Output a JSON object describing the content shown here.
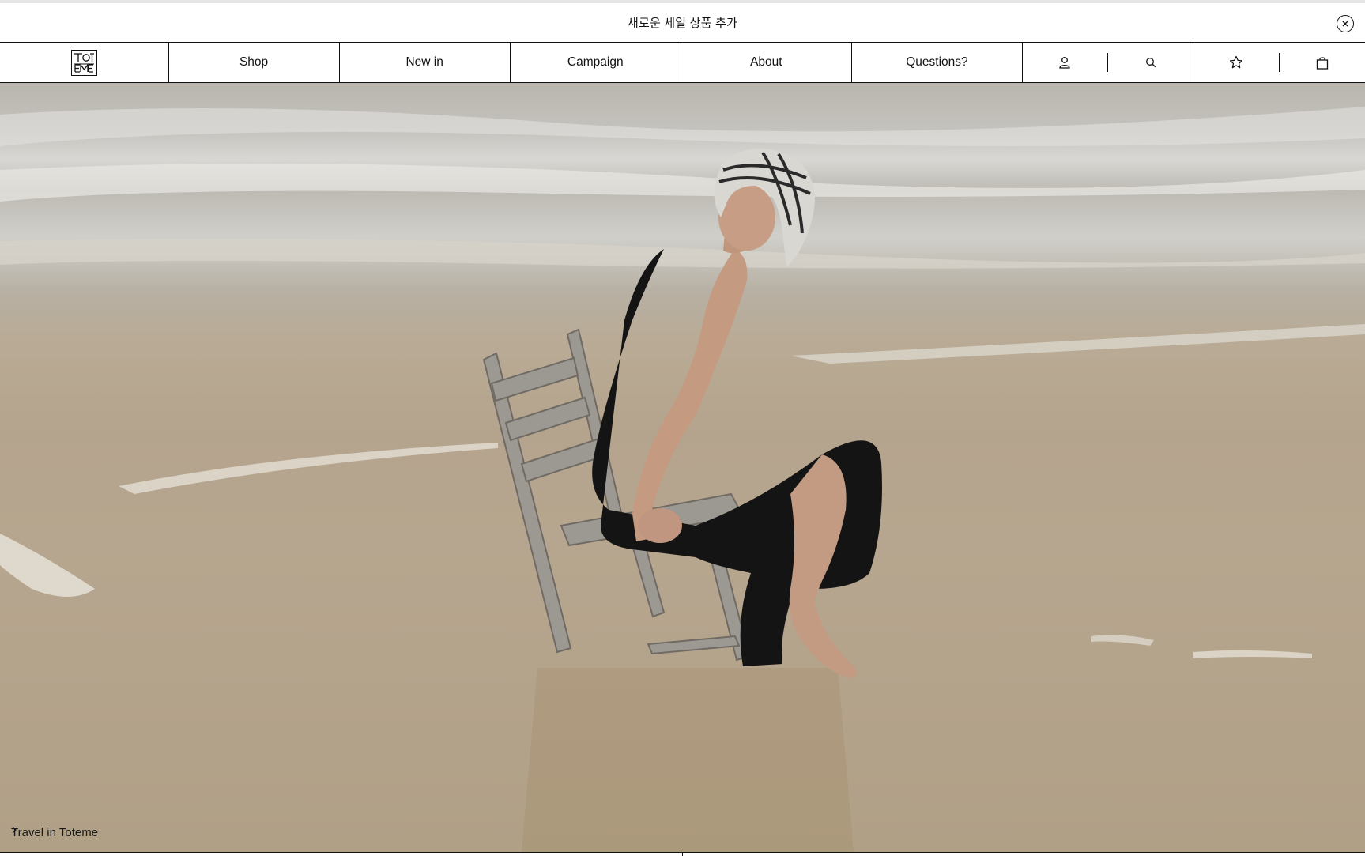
{
  "announcement": {
    "text": "새로운 세일 상품 추가",
    "close_icon": "close-icon"
  },
  "nav": {
    "logo_icon": "totem-logo",
    "links": [
      {
        "label": "Shop"
      },
      {
        "label": "New in"
      },
      {
        "label": "Campaign"
      },
      {
        "label": "About"
      },
      {
        "label": "Questions?"
      }
    ],
    "icons": [
      "account-icon",
      "search-icon",
      "wishlist-star-icon",
      "shopping-bag-icon"
    ]
  },
  "hero": {
    "caption": "Travel in Toteme",
    "caption_icon": "chevron-right-icon"
  }
}
